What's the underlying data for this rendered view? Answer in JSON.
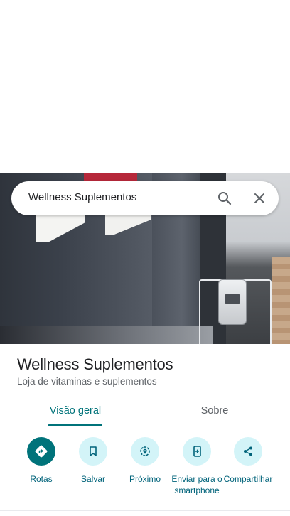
{
  "search": {
    "query": "Wellness Suplementos"
  },
  "place": {
    "name": "Wellness Suplementos",
    "category": "Loja de vitaminas e suplementos"
  },
  "tabs": [
    {
      "label": "Visão geral",
      "selected": true
    },
    {
      "label": "Sobre",
      "selected": false
    }
  ],
  "actions": [
    {
      "label": "Rotas",
      "icon": "directions-icon"
    },
    {
      "label": "Salvar",
      "icon": "bookmark-icon"
    },
    {
      "label": "Próximo",
      "icon": "nearby-icon"
    },
    {
      "label": "Enviar para o smartphone",
      "icon": "send-to-phone-icon"
    },
    {
      "label": "Compartilhar",
      "icon": "share-icon"
    }
  ],
  "colors": {
    "accent": "#00737a",
    "accent_light": "#d3f4f8",
    "text_primary": "#202124",
    "text_secondary": "#5f6368"
  }
}
